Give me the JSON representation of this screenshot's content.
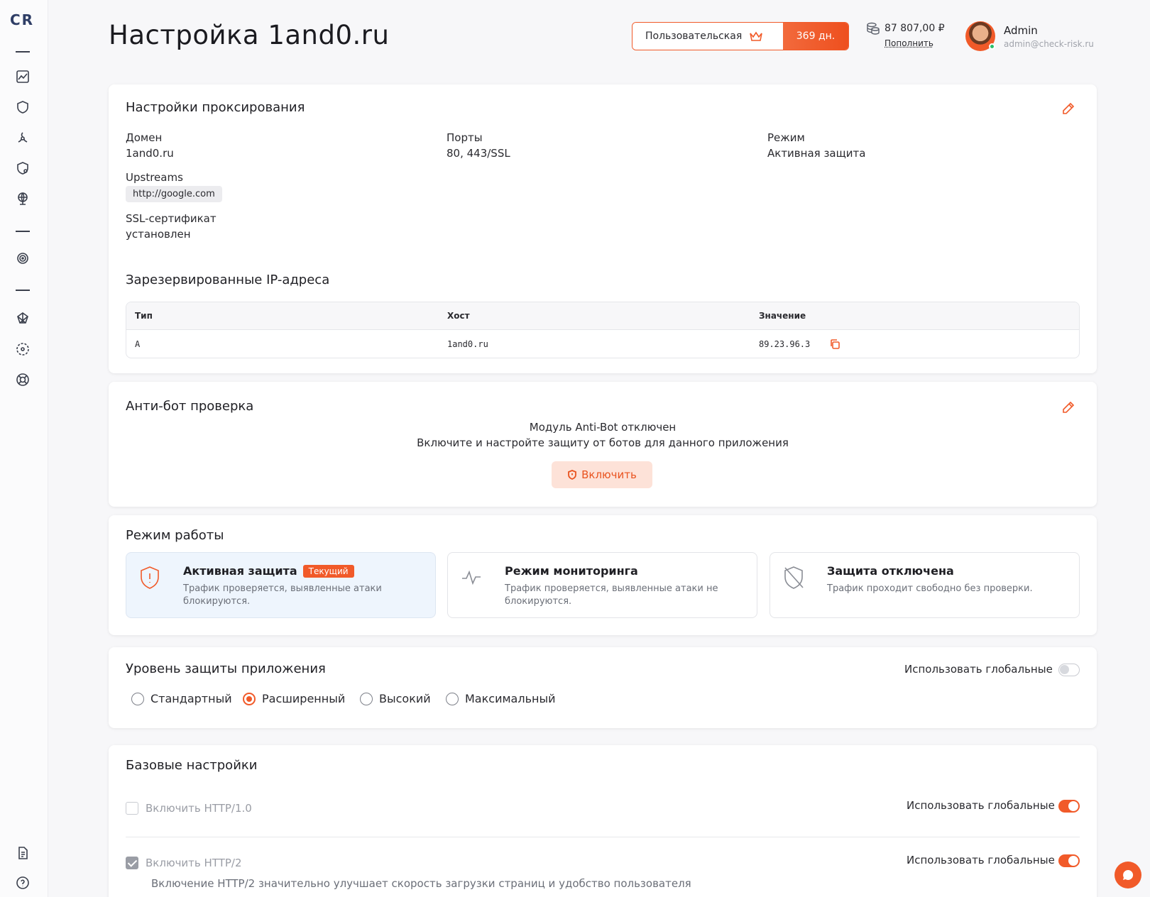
{
  "logo": "CR",
  "header": {
    "title": "Настройка 1and0.ru",
    "plan_name": "Пользовательская",
    "plan_days": "369 дн.",
    "balance": "87 807,00 ₽",
    "topup": "Пополнить",
    "user_name": "Admin",
    "user_email": "admin@check-risk.ru"
  },
  "proxy": {
    "title": "Настройки проксирования",
    "domain_label": "Домен",
    "domain_value": "1and0.ru",
    "ports_label": "Порты",
    "ports_value": "80, 443/SSL",
    "mode_label": "Режим",
    "mode_value": "Активная защита",
    "upstreams_label": "Upstreams",
    "upstream": "http://google.com",
    "ssl_label": "SSL-сертификат",
    "ssl_value": "установлен",
    "reserved_title": "Зарезервированные IP-адреса",
    "table": {
      "headers": [
        "Тип",
        "Хост",
        "Значение"
      ],
      "rows": [
        [
          "A",
          "1and0.ru",
          "89.23.96.3"
        ]
      ]
    }
  },
  "antibot": {
    "title": "Анти-бот проверка",
    "status": "Модуль Anti-Bot отключен",
    "hint": "Включите и настройте защиту от ботов для данного приложения",
    "button": "Включить"
  },
  "work_mode": {
    "title": "Режим работы",
    "modes": [
      {
        "title": "Активная защита",
        "badge": "Текущий",
        "desc": "Трафик проверяется, выявленные атаки блокируются."
      },
      {
        "title": "Режим мониторинга",
        "desc": "Трафик проверяется, выявленные атаки не блокируются."
      },
      {
        "title": "Защита отключена",
        "desc": "Трафик проходит свободно без проверки."
      }
    ]
  },
  "protection": {
    "title": "Уровень защиты приложения",
    "use_global": "Использовать глобальные",
    "use_global_enabled": false,
    "levels": [
      "Стандартный",
      "Расширенный",
      "Высокий",
      "Максимальный"
    ],
    "selected": "Расширенный"
  },
  "basic": {
    "title": "Базовые настройки",
    "items": [
      {
        "label": "Включить HTTP/1.0",
        "checked": false,
        "use_global": "Использовать глобальные",
        "global_enabled": true
      },
      {
        "label": "Включить HTTP/2",
        "checked": true,
        "use_global": "Использовать глобальные",
        "global_enabled": true,
        "desc": "Включение HTTP/2 значительно улучшает скорость загрузки страниц и удобство пользователя"
      }
    ]
  },
  "colors": {
    "accent": "#f15a29",
    "active_mode_bg": "#eef5fd",
    "online": "#2bbf6a"
  }
}
